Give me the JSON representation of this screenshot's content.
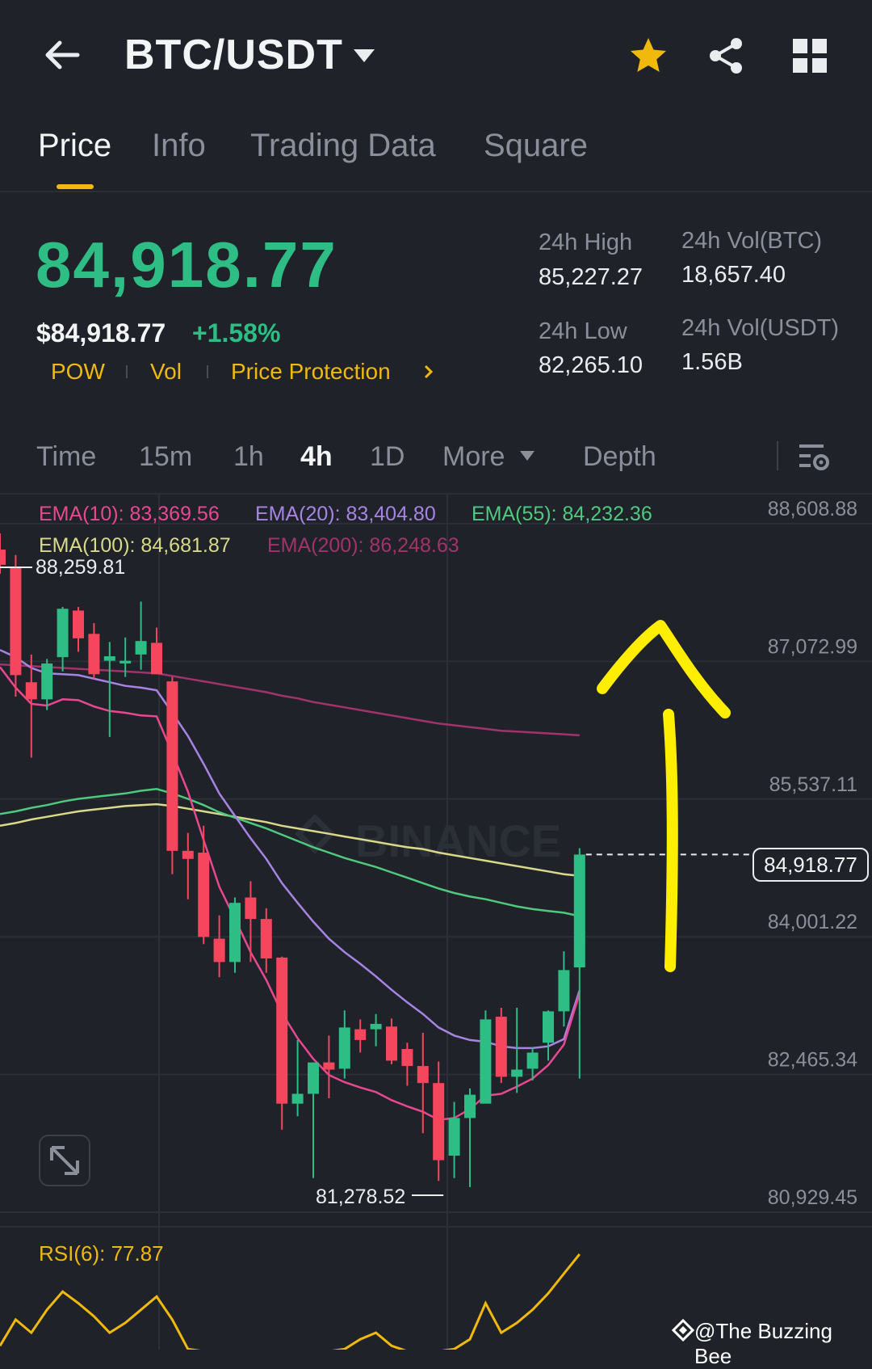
{
  "header": {
    "pair": "BTC/USDT",
    "icons": [
      "back-arrow-icon",
      "caret-down-icon",
      "star-icon",
      "share-icon",
      "grid-icon"
    ]
  },
  "tabs": [
    {
      "label": "Price",
      "active": true
    },
    {
      "label": "Info",
      "active": false
    },
    {
      "label": "Trading Data",
      "active": false
    },
    {
      "label": "Square",
      "active": false
    }
  ],
  "ticker": {
    "last_price": "84,918.77",
    "usd_price": "$84,918.77",
    "change": "+1.58%",
    "tags": [
      "POW",
      "Vol",
      "Price Protection"
    ],
    "high_label": "24h High",
    "high_value": "85,227.27",
    "low_label": "24h Low",
    "low_value": "82,265.10",
    "vol_btc_label": "24h Vol(BTC)",
    "vol_btc_value": "18,657.40",
    "vol_usdt_label": "24h Vol(USDT)",
    "vol_usdt_value": "1.56B"
  },
  "intervals": {
    "time": "Time",
    "i15m": "15m",
    "i1h": "1h",
    "i4h": "4h",
    "i1d": "1D",
    "more": "More",
    "depth": "Depth",
    "active": "4h"
  },
  "ema": {
    "ema10": "EMA(10): 83,369.56",
    "ema20": "EMA(20): 83,404.80",
    "ema55": "EMA(55): 84,232.36",
    "ema100": "EMA(100): 84,681.87",
    "ema200": "EMA(200): 86,248.63"
  },
  "colors": {
    "up": "#2ebd85",
    "down": "#f6465d",
    "ema10": "#e8488f",
    "ema20": "#a783e3",
    "ema55": "#4ec97e",
    "ema100": "#d9d98a",
    "ema200": "#a2336a",
    "accent": "#f0b90b",
    "annotation": "#ffee00"
  },
  "chart_data": {
    "type": "candlestick",
    "interval": "4h",
    "price_axis": [
      "88,608.88",
      "87,072.99",
      "85,537.11",
      "84,001.22",
      "82,465.34",
      "80,929.45"
    ],
    "ylim": [
      80929.45,
      88608.88
    ],
    "high_marker": "88,259.81",
    "low_marker": "81,278.52",
    "current_price": "84,918.77",
    "candles": [
      {
        "o": 88320,
        "h": 88500,
        "l": 88050,
        "c": 88150
      },
      {
        "o": 88120,
        "h": 88259.81,
        "l": 86680,
        "c": 86920
      },
      {
        "o": 86840,
        "h": 87150,
        "l": 86000,
        "c": 86650
      },
      {
        "o": 86650,
        "h": 87100,
        "l": 86530,
        "c": 87050
      },
      {
        "o": 87120,
        "h": 87680,
        "l": 86960,
        "c": 87660
      },
      {
        "o": 87640,
        "h": 87680,
        "l": 87180,
        "c": 87330
      },
      {
        "o": 87380,
        "h": 87500,
        "l": 86880,
        "c": 86930
      },
      {
        "o": 87080,
        "h": 87290,
        "l": 86230,
        "c": 87130
      },
      {
        "o": 87050,
        "h": 87340,
        "l": 86900,
        "c": 87080
      },
      {
        "o": 87150,
        "h": 87740,
        "l": 86980,
        "c": 87300
      },
      {
        "o": 87280,
        "h": 87450,
        "l": 86950,
        "c": 86930
      },
      {
        "o": 86850,
        "h": 86900,
        "l": 84700,
        "c": 84960
      },
      {
        "o": 84960,
        "h": 85160,
        "l": 84420,
        "c": 84870
      },
      {
        "o": 84940,
        "h": 85240,
        "l": 83920,
        "c": 84000
      },
      {
        "o": 83980,
        "h": 84240,
        "l": 83550,
        "c": 83720
      },
      {
        "o": 83720,
        "h": 84440,
        "l": 83600,
        "c": 84380
      },
      {
        "o": 84440,
        "h": 84620,
        "l": 83720,
        "c": 84200
      },
      {
        "o": 84200,
        "h": 84320,
        "l": 83600,
        "c": 83760
      },
      {
        "o": 83770,
        "h": 83780,
        "l": 81850,
        "c": 82140
      },
      {
        "o": 82140,
        "h": 82850,
        "l": 82000,
        "c": 82250
      },
      {
        "o": 82250,
        "h": 82600,
        "l": 81310,
        "c": 82600
      },
      {
        "o": 82600,
        "h": 82900,
        "l": 82200,
        "c": 82520
      },
      {
        "o": 82530,
        "h": 83180,
        "l": 82420,
        "c": 82990
      },
      {
        "o": 82970,
        "h": 83080,
        "l": 82710,
        "c": 82850
      },
      {
        "o": 82970,
        "h": 83140,
        "l": 82780,
        "c": 83030
      },
      {
        "o": 83000,
        "h": 83090,
        "l": 82580,
        "c": 82620
      },
      {
        "o": 82750,
        "h": 82820,
        "l": 82340,
        "c": 82560
      },
      {
        "o": 82560,
        "h": 82930,
        "l": 81810,
        "c": 82370
      },
      {
        "o": 82370,
        "h": 82610,
        "l": 81278.52,
        "c": 81510
      },
      {
        "o": 81560,
        "h": 82160,
        "l": 81310,
        "c": 81980
      },
      {
        "o": 81980,
        "h": 82310,
        "l": 81210,
        "c": 82240
      },
      {
        "o": 82140,
        "h": 83180,
        "l": 82170,
        "c": 83080
      },
      {
        "o": 83110,
        "h": 83210,
        "l": 82370,
        "c": 82440
      },
      {
        "o": 82440,
        "h": 83210,
        "l": 82260,
        "c": 82520
      },
      {
        "o": 82530,
        "h": 82770,
        "l": 82400,
        "c": 82710
      },
      {
        "o": 82820,
        "h": 83180,
        "l": 82620,
        "c": 83170
      },
      {
        "o": 83170,
        "h": 83840,
        "l": 83000,
        "c": 83630
      },
      {
        "o": 83660,
        "h": 84990,
        "l": 82420,
        "c": 84918.77
      }
    ],
    "ema_series": {
      "ema10": [
        87010,
        86780,
        86600,
        86580,
        86650,
        86640,
        86570,
        86520,
        86500,
        86470,
        86460,
        86050,
        85620,
        85080,
        84560,
        84200,
        83830,
        83520,
        83150,
        82870,
        82640,
        82460,
        82380,
        82320,
        82270,
        82180,
        82110,
        82050,
        81960,
        81980,
        82080,
        82230,
        82250,
        82330,
        82420,
        82570,
        82800,
        83369.56
      ],
      "ema20": [
        87200,
        87120,
        87000,
        86940,
        86930,
        86920,
        86880,
        86840,
        86800,
        86780,
        86750,
        86500,
        86240,
        85930,
        85600,
        85350,
        85100,
        84870,
        84600,
        84380,
        84170,
        83980,
        83830,
        83700,
        83560,
        83410,
        83270,
        83140,
        82990,
        82900,
        82850,
        82830,
        82780,
        82760,
        82760,
        82780,
        82860,
        83404.8
      ],
      "ema55": [
        85370,
        85400,
        85440,
        85470,
        85510,
        85540,
        85560,
        85580,
        85600,
        85630,
        85650,
        85600,
        85540,
        85470,
        85390,
        85330,
        85270,
        85210,
        85140,
        85070,
        85000,
        84940,
        84880,
        84830,
        84780,
        84720,
        84660,
        84600,
        84540,
        84490,
        84450,
        84420,
        84380,
        84340,
        84310,
        84290,
        84270,
        84232.36
      ],
      "ema100": [
        85240,
        85270,
        85310,
        85340,
        85370,
        85400,
        85420,
        85440,
        85460,
        85470,
        85480,
        85460,
        85430,
        85400,
        85370,
        85340,
        85310,
        85280,
        85240,
        85210,
        85180,
        85150,
        85120,
        85090,
        85060,
        85030,
        85000,
        84980,
        84940,
        84910,
        84880,
        84850,
        84820,
        84790,
        84760,
        84730,
        84700,
        84681.87
      ],
      "ema200": [
        87040,
        87030,
        87020,
        87010,
        87000,
        86990,
        86980,
        86970,
        86960,
        86950,
        86940,
        86910,
        86880,
        86850,
        86820,
        86790,
        86760,
        86730,
        86690,
        86660,
        86620,
        86590,
        86560,
        86530,
        86500,
        86470,
        86440,
        86410,
        86380,
        86360,
        86340,
        86320,
        86300,
        86290,
        86280,
        86270,
        86260,
        86248.63
      ]
    },
    "rsi": {
      "label": "RSI(6): 77.87",
      "values": [
        22,
        38,
        30,
        44,
        55,
        48,
        40,
        30,
        36,
        44,
        52,
        38,
        20,
        14,
        10,
        18,
        14,
        8,
        6,
        10,
        8,
        14,
        20,
        26,
        30,
        22,
        16,
        18,
        12,
        20,
        26,
        48,
        30,
        36,
        44,
        54,
        66,
        77.87
      ]
    },
    "annotation": "hand-drawn yellow up arrow"
  },
  "watermark": {
    "logo": "BINANCE",
    "credit": "@The Buzzing Bee"
  }
}
